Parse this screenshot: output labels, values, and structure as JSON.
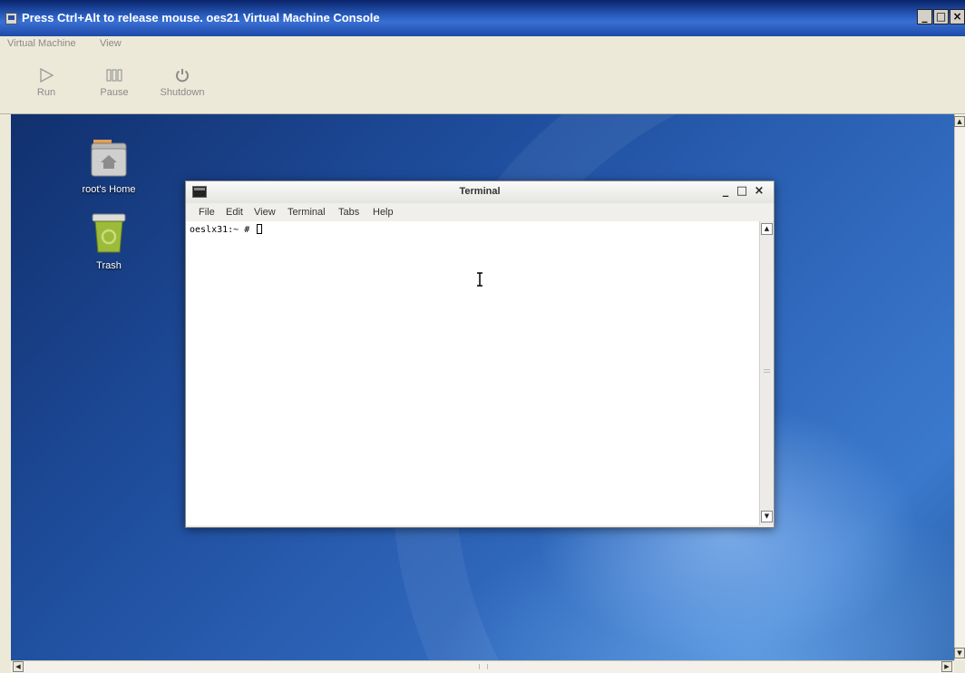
{
  "host_window": {
    "title": "Press Ctrl+Alt to release mouse. oes21 Virtual Machine Console",
    "buttons": {
      "minimize": "_",
      "maximize": "□",
      "close": "×"
    }
  },
  "host_menu": {
    "items": [
      "Virtual Machine",
      "View"
    ]
  },
  "toolbar": {
    "run_label": "Run",
    "pause_label": "Pause",
    "shutdown_label": "Shutdown"
  },
  "desktop": {
    "icons": [
      {
        "label": "root's Home",
        "icon": "home-folder-icon"
      },
      {
        "label": "Trash",
        "icon": "trash-icon"
      }
    ]
  },
  "terminal": {
    "title": "Terminal",
    "menu": [
      "File",
      "Edit",
      "View",
      "Terminal",
      "Tabs",
      "Help"
    ],
    "prompt": "oeslx31:~ # "
  },
  "colors": {
    "titlebar": "#2a5fc2",
    "chrome": "#ece9d8",
    "desktop_blue": "#2d64b8"
  }
}
